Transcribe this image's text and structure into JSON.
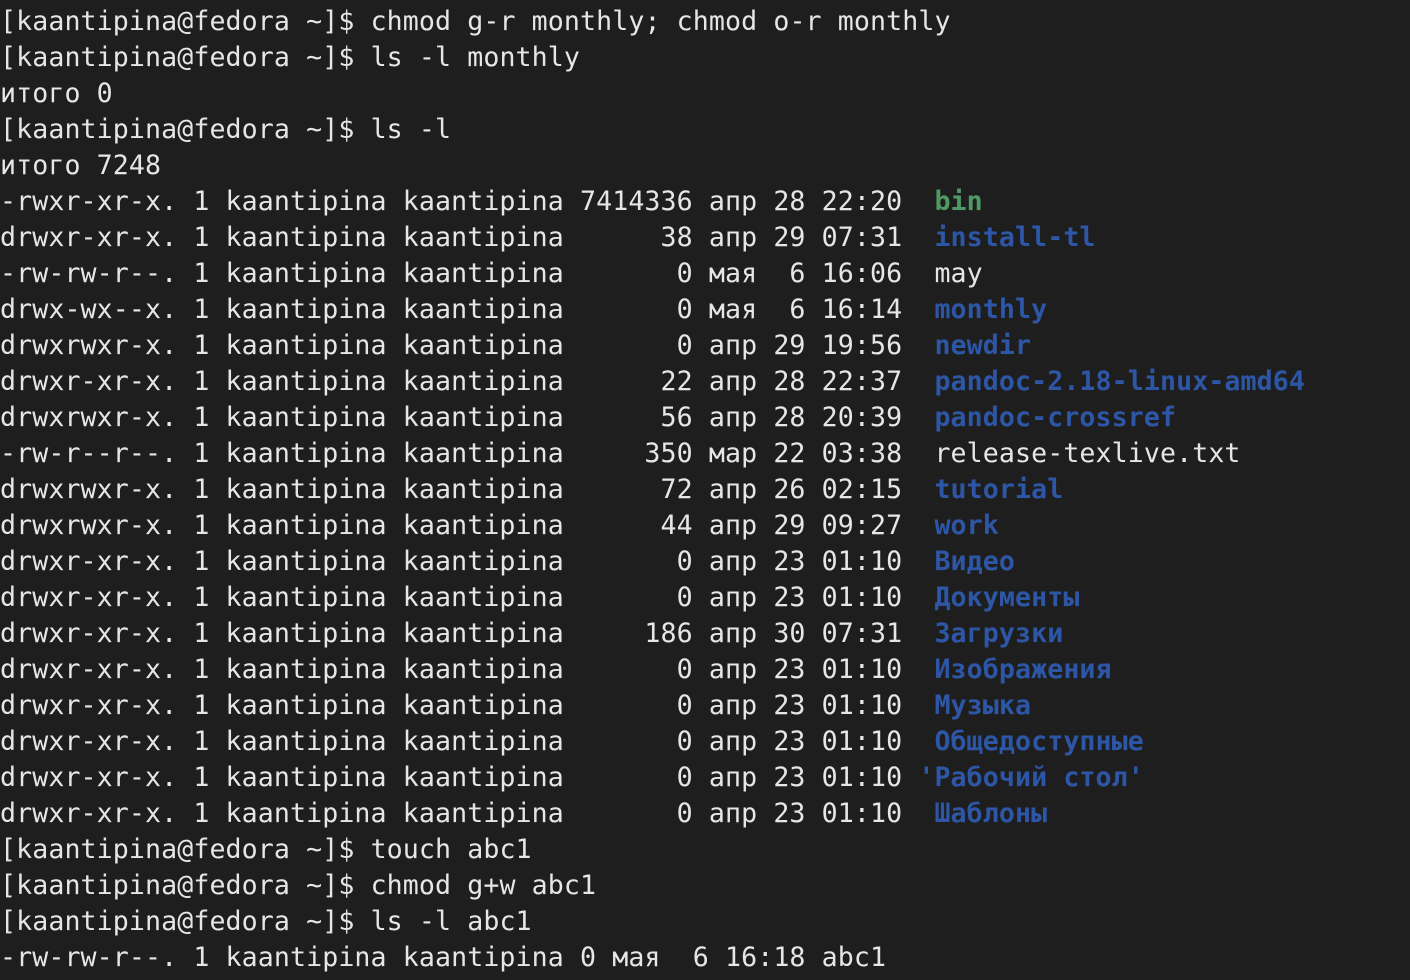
{
  "lines": [
    {
      "kind": "prompt",
      "prompt": "[kaantipina@fedora ~]$ ",
      "command": "chmod g-r monthly; chmod o-r monthly"
    },
    {
      "kind": "prompt",
      "prompt": "[kaantipina@fedora ~]$ ",
      "command": "ls -l monthly"
    },
    {
      "kind": "text",
      "text": "итого 0"
    },
    {
      "kind": "prompt",
      "prompt": "[kaantipina@fedora ~]$ ",
      "command": "ls -l"
    },
    {
      "kind": "text",
      "text": "итого 7248"
    },
    {
      "kind": "entry",
      "prefix": "-rwxr-xr-x. 1 kaantipina kaantipina 7414336 апр 28 22:20  ",
      "name": "bin",
      "type": "exec"
    },
    {
      "kind": "entry",
      "prefix": "drwxr-xr-x. 1 kaantipina kaantipina      38 апр 29 07:31  ",
      "name": "install-tl",
      "type": "dir"
    },
    {
      "kind": "entry",
      "prefix": "-rw-rw-r--. 1 kaantipina kaantipina       0 мая  6 16:06  ",
      "name": "may",
      "type": "file"
    },
    {
      "kind": "entry",
      "prefix": "drwx-wx--x. 1 kaantipina kaantipina       0 мая  6 16:14  ",
      "name": "monthly",
      "type": "dir"
    },
    {
      "kind": "entry",
      "prefix": "drwxrwxr-x. 1 kaantipina kaantipina       0 апр 29 19:56  ",
      "name": "newdir",
      "type": "dir"
    },
    {
      "kind": "entry",
      "prefix": "drwxr-xr-x. 1 kaantipina kaantipina      22 апр 28 22:37  ",
      "name": "pandoc-2.18-linux-amd64",
      "type": "dir"
    },
    {
      "kind": "entry",
      "prefix": "drwxrwxr-x. 1 kaantipina kaantipina      56 апр 28 20:39  ",
      "name": "pandoc-crossref",
      "type": "dir"
    },
    {
      "kind": "entry",
      "prefix": "-rw-r--r--. 1 kaantipina kaantipina     350 мар 22 03:38  ",
      "name": "release-texlive.txt",
      "type": "file"
    },
    {
      "kind": "entry",
      "prefix": "drwxrwxr-x. 1 kaantipina kaantipina      72 апр 26 02:15  ",
      "name": "tutorial",
      "type": "dir"
    },
    {
      "kind": "entry",
      "prefix": "drwxrwxr-x. 1 kaantipina kaantipina      44 апр 29 09:27  ",
      "name": "work",
      "type": "dir"
    },
    {
      "kind": "entry",
      "prefix": "drwxr-xr-x. 1 kaantipina kaantipina       0 апр 23 01:10  ",
      "name": "Видео",
      "type": "dir"
    },
    {
      "kind": "entry",
      "prefix": "drwxr-xr-x. 1 kaantipina kaantipina       0 апр 23 01:10  ",
      "name": "Документы",
      "type": "dir"
    },
    {
      "kind": "entry",
      "prefix": "drwxr-xr-x. 1 kaantipina kaantipina     186 апр 30 07:31  ",
      "name": "Загрузки",
      "type": "dir"
    },
    {
      "kind": "entry",
      "prefix": "drwxr-xr-x. 1 kaantipina kaantipina       0 апр 23 01:10  ",
      "name": "Изображения",
      "type": "dir"
    },
    {
      "kind": "entry",
      "prefix": "drwxr-xr-x. 1 kaantipina kaantipina       0 апр 23 01:10  ",
      "name": "Музыка",
      "type": "dir"
    },
    {
      "kind": "entry",
      "prefix": "drwxr-xr-x. 1 kaantipina kaantipina       0 апр 23 01:10  ",
      "name": "Общедоступные",
      "type": "dir"
    },
    {
      "kind": "entry",
      "prefix": "drwxr-xr-x. 1 kaantipina kaantipina       0 апр 23 01:10 ",
      "name": "'Рабочий стол'",
      "type": "dir"
    },
    {
      "kind": "entry",
      "prefix": "drwxr-xr-x. 1 kaantipina kaantipina       0 апр 23 01:10  ",
      "name": "Шаблоны",
      "type": "dir"
    },
    {
      "kind": "prompt",
      "prompt": "[kaantipina@fedora ~]$ ",
      "command": "touch abc1"
    },
    {
      "kind": "prompt",
      "prompt": "[kaantipina@fedora ~]$ ",
      "command": "chmod g+w abc1"
    },
    {
      "kind": "prompt",
      "prompt": "[kaantipina@fedora ~]$ ",
      "command": "ls -l abc1"
    },
    {
      "kind": "text",
      "text": "-rw-rw-r--. 1 kaantipina kaantipina 0 мая  6 16:18 abc1"
    }
  ],
  "colors": {
    "background": "#1e1e1e",
    "foreground": "#e6e6e6",
    "exec": "#4e9a64",
    "dir": "#2d56a6"
  }
}
